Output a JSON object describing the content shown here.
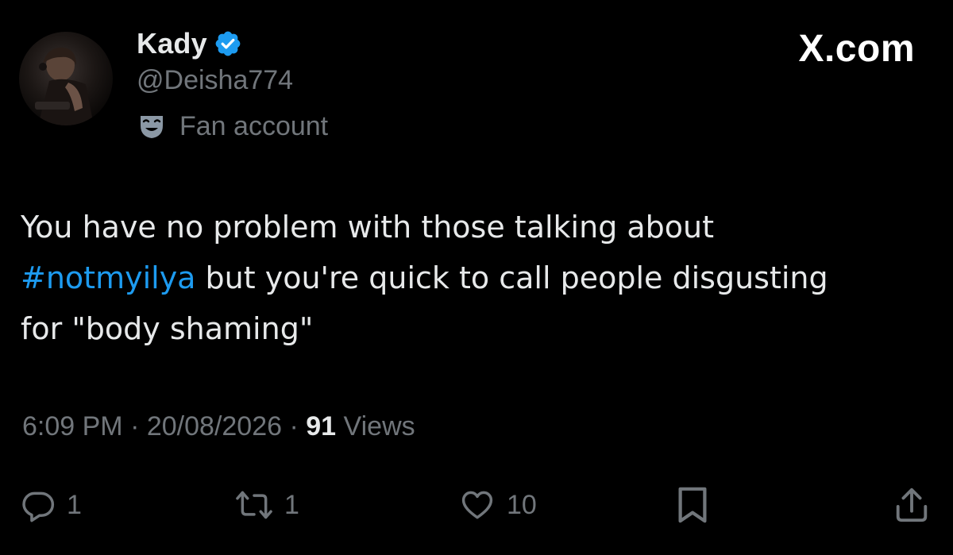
{
  "author": {
    "display_name": "Kady",
    "handle": "@Deisha774",
    "label": "Fan account",
    "verified": true
  },
  "brand": "X.com",
  "post": {
    "text_line1": "You have no problem with those talking about",
    "hashtag": "#notmyilya",
    "text_line2_rest": " but you're quick to call people disgusting",
    "text_line3": "for \"body shaming\""
  },
  "meta": {
    "time": "6:09 PM",
    "separator": "·",
    "date": "20/08/2026",
    "views_count": "91",
    "views_label": "Views"
  },
  "actions": {
    "replies": "1",
    "reposts": "1",
    "likes": "10"
  },
  "colors": {
    "background": "#000000",
    "text_primary": "#e7e9ea",
    "text_secondary": "#71767b",
    "accent_blue": "#1d9bf0"
  },
  "icons": [
    "verified-badge-icon",
    "theater-masks-icon",
    "reply-icon",
    "repost-icon",
    "like-icon",
    "bookmark-icon",
    "share-icon"
  ]
}
